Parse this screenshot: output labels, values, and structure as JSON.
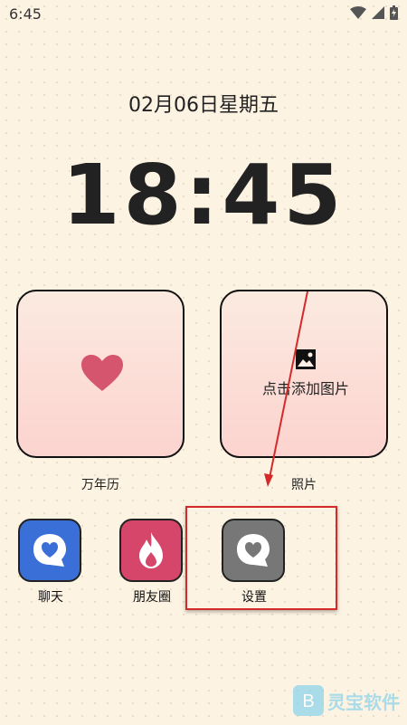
{
  "status": {
    "time": "6:45"
  },
  "date": "02月06日星期五",
  "clock": "18:45",
  "widgets": {
    "calendar_label": "万年历",
    "photo_label": "照片",
    "photo_hint": "点击添加图片"
  },
  "apps": [
    {
      "label": "聊天",
      "color": "#3a6fd8"
    },
    {
      "label": "朋友圈",
      "color": "#d6456a"
    },
    {
      "label": "设置",
      "color": "#777777"
    }
  ],
  "watermark": "灵宝软件",
  "colors": {
    "accent_red": "#d42a2a",
    "heart": "#d6556e"
  }
}
